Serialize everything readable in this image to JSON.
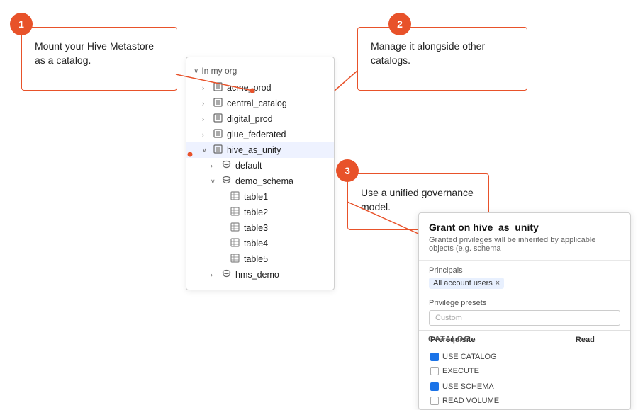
{
  "steps": [
    {
      "id": 1,
      "label": "1",
      "text": "Mount your Hive Metastore as a catalog."
    },
    {
      "id": 2,
      "label": "2",
      "text": "Manage it alongside other catalogs."
    },
    {
      "id": 3,
      "label": "3",
      "text": "Use a unified governance model."
    }
  ],
  "tree": {
    "header": "In my org",
    "items": [
      {
        "indent": 1,
        "arrow": "›",
        "icon": "▣",
        "label": "acme_prod",
        "selected": false
      },
      {
        "indent": 1,
        "arrow": "›",
        "icon": "▣",
        "label": "central_catalog",
        "selected": false
      },
      {
        "indent": 1,
        "arrow": "›",
        "icon": "◧",
        "label": "digital_prod",
        "selected": false
      },
      {
        "indent": 1,
        "arrow": "›",
        "icon": "▣",
        "label": "glue_federated",
        "selected": false
      },
      {
        "indent": 1,
        "arrow": "∨",
        "icon": "▣",
        "label": "hive_as_unity",
        "selected": true
      },
      {
        "indent": 2,
        "arrow": "›",
        "icon": "⊟",
        "label": "default",
        "selected": false
      },
      {
        "indent": 2,
        "arrow": "∨",
        "icon": "⊟",
        "label": "demo_schema",
        "selected": false
      },
      {
        "indent": 3,
        "arrow": "",
        "icon": "⊞",
        "label": "table1",
        "selected": false
      },
      {
        "indent": 3,
        "arrow": "",
        "icon": "⊞",
        "label": "table2",
        "selected": false
      },
      {
        "indent": 3,
        "arrow": "",
        "icon": "⊞",
        "label": "table3",
        "selected": false
      },
      {
        "indent": 3,
        "arrow": "",
        "icon": "⊞",
        "label": "table4",
        "selected": false
      },
      {
        "indent": 3,
        "arrow": "",
        "icon": "⊞",
        "label": "table5",
        "selected": false
      },
      {
        "indent": 2,
        "arrow": "›",
        "icon": "⊟",
        "label": "hms_demo",
        "selected": false
      }
    ]
  },
  "grant_dialog": {
    "title": "Grant on hive_as_unity",
    "subtitle": "Granted privileges will be inherited by applicable objects (e.g. schema",
    "principals_label": "Principals",
    "principals_tag": "All account users",
    "privilege_label": "Privilege presets",
    "privilege_placeholder": "Custom",
    "table_headers": [
      "Prerequisite",
      "Read"
    ],
    "table_rows": [
      {
        "prereq_checked": true,
        "prereq": "USE CATALOG",
        "read_checked": false,
        "read": "EXECUTE"
      },
      {
        "prereq_checked": true,
        "prereq": "USE SCHEMA",
        "read_checked": false,
        "read": "READ VOLUME"
      }
    ]
  },
  "catalog_label": "CATALOG"
}
